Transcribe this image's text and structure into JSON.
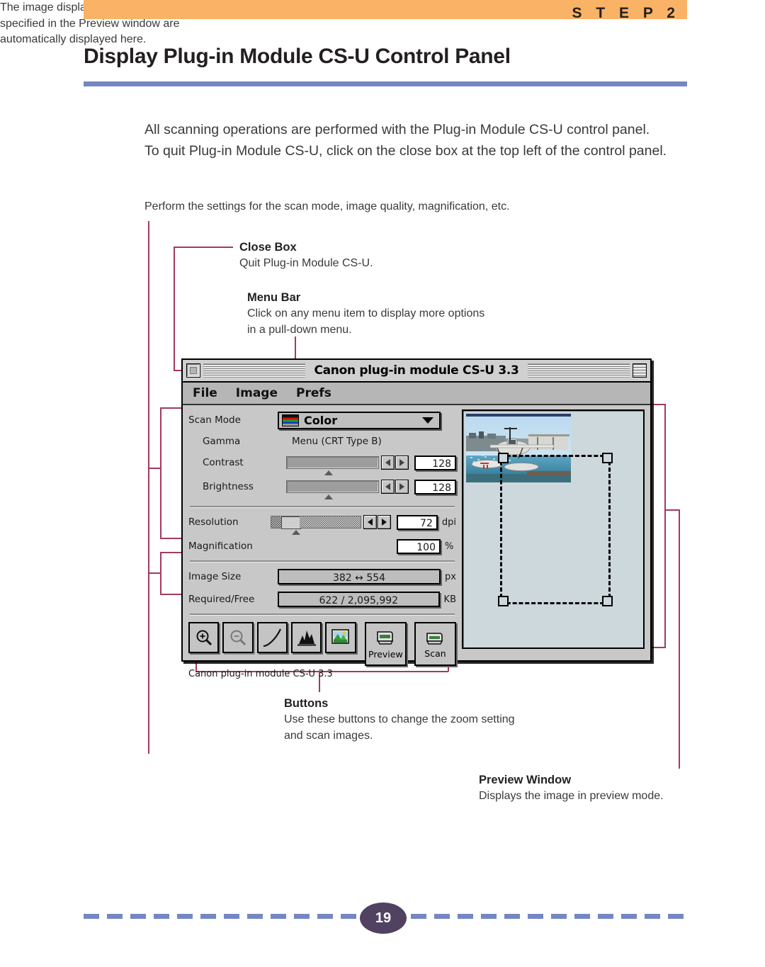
{
  "header": {
    "step_label": "S T E P   2",
    "title": "Display Plug-in Module CS-U Control Panel",
    "accent_orange": "#f9b266",
    "accent_blue": "#7487c4"
  },
  "intro": {
    "line1": "All scanning operations are performed with the Plug-in Module CS-U control panel.",
    "line2": "To quit Plug-in Module CS-U, click on the close box at the top left of the control panel."
  },
  "perform_note": "Perform the settings for the scan mode, image quality, magnification, etc.",
  "callouts": {
    "close_box": {
      "heading": "Close Box",
      "body": "Quit Plug-in Module CS-U."
    },
    "menu_bar": {
      "heading": "Menu Bar",
      "body": "Click on any menu item to display more options in a pull-down menu."
    },
    "buttons": {
      "heading": "Buttons",
      "body": "Use these buttons to change the zoom setting and scan images."
    },
    "image_size": {
      "body": "The image display size and disk size that were specified in the Preview window are automatically displayed here."
    },
    "preview_window": {
      "heading": "Preview Window",
      "body": "Displays the image in preview mode."
    },
    "leader_color": "#a33b5e"
  },
  "app_window": {
    "title": "Canon plug-in module CS-U 3.3",
    "menus": [
      "File",
      "Image",
      "Prefs"
    ],
    "controls": {
      "scan_mode": {
        "label": "Scan Mode",
        "value": "Color"
      },
      "gamma": {
        "label": "Gamma",
        "value": "Menu (CRT Type B)"
      },
      "contrast": {
        "label": "Contrast",
        "value": "128"
      },
      "brightness": {
        "label": "Brightness",
        "value": "128"
      },
      "resolution": {
        "label": "Resolution",
        "value": "72",
        "unit": "dpi"
      },
      "magnification": {
        "label": "Magnification",
        "value": "100",
        "unit": "%"
      },
      "image_size": {
        "label": "Image Size",
        "value": "382 ↔ 554",
        "unit": "px"
      },
      "required_free": {
        "label": "Required/Free",
        "value": "622 / 2,095,992",
        "unit": "KB"
      }
    },
    "toolbar": {
      "zoom_in": "zoom-in-icon",
      "zoom_out": "zoom-out-icon",
      "tone_curve": "tone-curve-icon",
      "histogram": "histogram-icon",
      "image_adjust": "image-adjust-icon",
      "preview_label": "Preview",
      "scan_label": "Scan"
    },
    "status": "Canon plug-in module CS-U 3.3"
  },
  "footer": {
    "page_number": "19",
    "bubble_color": "#514262",
    "dash_color": "#7487c4"
  }
}
